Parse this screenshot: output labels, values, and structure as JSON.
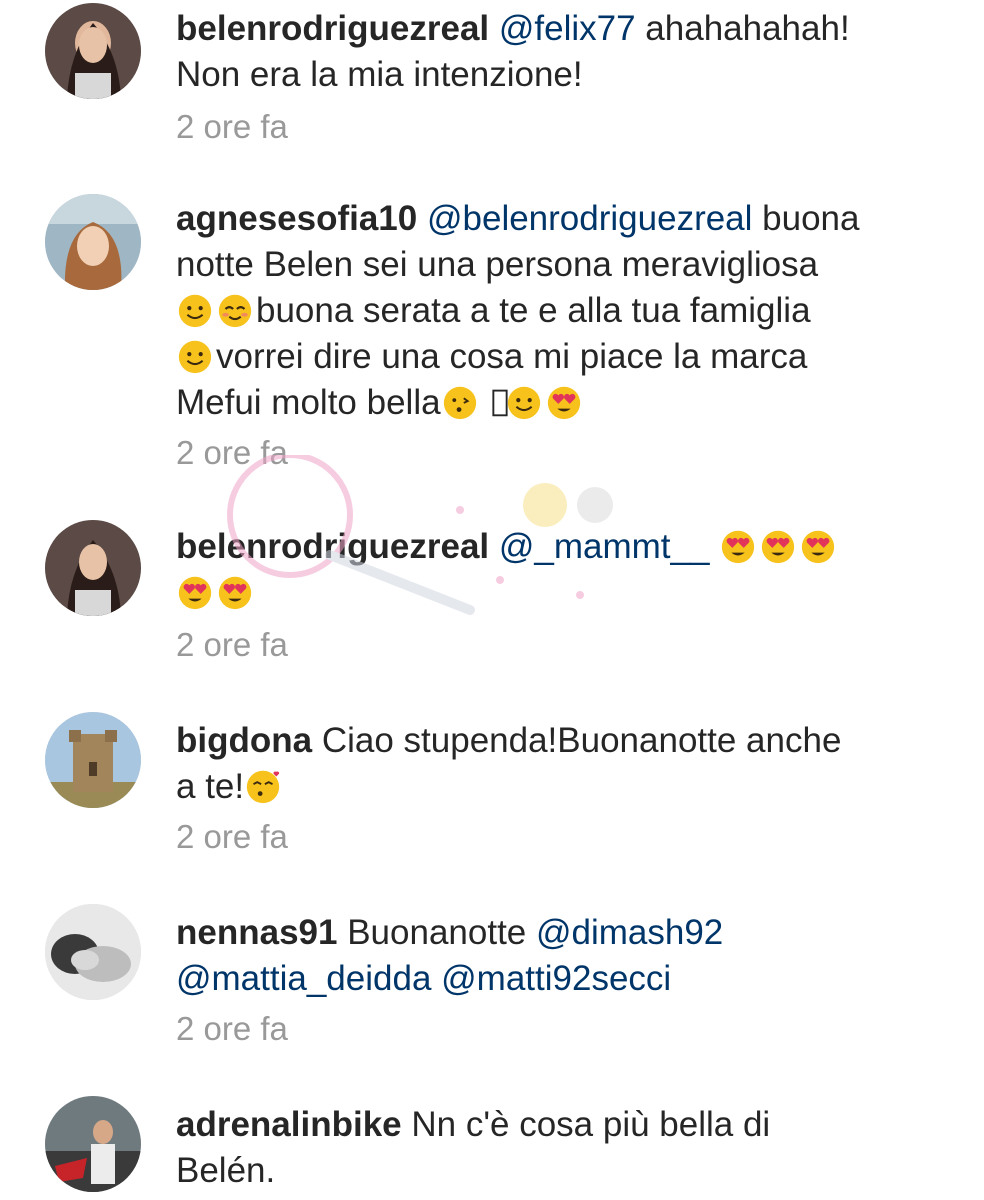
{
  "comments": [
    {
      "username": "belenrodriguezreal",
      "mention": "@felix77",
      "text_line1": " ahahahahah!",
      "text_line2": "Non era la mia intenzione!",
      "time": "2 ore fa"
    },
    {
      "username": "agnesesofia10",
      "mention": "@belenrodriguezreal",
      "text_line1": " buona",
      "text_line2": "notte Belen sei una persona meravigliosa",
      "text_line3": "buona serata a te e alla tua famiglia",
      "text_line4": "vorrei dire una cosa mi piace la marca",
      "text_line5": "Mefui molto bella",
      "time": "2 ore fa"
    },
    {
      "username": "belenrodriguezreal",
      "mention": "@_mammt__",
      "time": "2 ore fa"
    },
    {
      "username": "bigdona",
      "text_line1": "Ciao stupenda!Buonanotte anche",
      "text_line2": "a te!",
      "time": "2 ore fa"
    },
    {
      "username": "nennas91",
      "text_line1": "Buonanotte ",
      "mention1": "@dimash92",
      "mention2": "@mattia_deidda",
      "mention3": "@matti92secci",
      "time": "2 ore fa"
    },
    {
      "username": "adrenalinbike",
      "text_line1": "Nn c'è cosa più bella di",
      "text_line2": "Belén."
    }
  ],
  "icons": {
    "smile": "smiling-face-icon",
    "blush": "blushing-face-icon",
    "heart_eyes": "heart-eyes-icon",
    "kiss": "kissing-face-icon"
  },
  "colors": {
    "text": "#262626",
    "mention": "#003569",
    "timestamp": "#999999",
    "emoji": "#f7c21b"
  }
}
